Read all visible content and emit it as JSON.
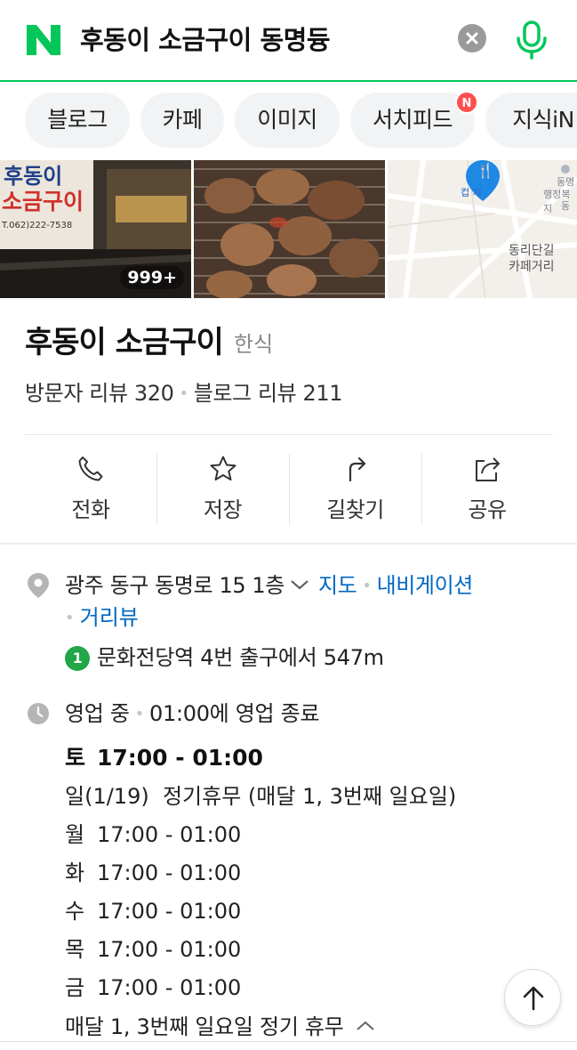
{
  "search": {
    "logo": "N",
    "query": "후동이 소금구이 동명듕"
  },
  "tabs": [
    {
      "label": "블로그"
    },
    {
      "label": "카페"
    },
    {
      "label": "이미지"
    },
    {
      "label": "서치피드",
      "badge": "N"
    },
    {
      "label": "지식iN"
    }
  ],
  "photos": {
    "sign_line1": "후동이",
    "sign_line2": "소금구이",
    "sign_phone": "T.062)222-7538",
    "count": "999+",
    "map_label1": "동리단길",
    "map_label2": "카페거리",
    "map_label3": "동명",
    "map_label4": "행정복지",
    "map_label5": "동",
    "map_pin_text": "컵",
    "map_pin_text2": "지"
  },
  "place": {
    "name": "후동이 소금구이",
    "category": "한식",
    "visitor_reviews": "방문자 리뷰 320",
    "blog_reviews": "블로그 리뷰 211"
  },
  "actions": [
    {
      "label": "전화",
      "icon": "phone-icon"
    },
    {
      "label": "저장",
      "icon": "star-icon"
    },
    {
      "label": "길찾기",
      "icon": "directions-icon"
    },
    {
      "label": "공유",
      "icon": "share-icon"
    }
  ],
  "address": {
    "text": "광주 동구 동명로 15 1층",
    "map_link": "지도",
    "nav_link": "내비게이션",
    "streetview_link": "거리뷰"
  },
  "subway": {
    "line": "1",
    "line_color": "#22a648",
    "text": "문화전당역 4번 출구에서 547m"
  },
  "hours": {
    "status": "영업 중",
    "closing": "01:00에 영업 종료",
    "rows": [
      {
        "day": "토",
        "time": "17:00 - 01:00"
      },
      {
        "day": "일(1/19)",
        "time": "정기휴무 (매달 1, 3번째 일요일)"
      },
      {
        "day": "월",
        "time": "17:00 - 01:00"
      },
      {
        "day": "화",
        "time": "17:00 - 01:00"
      },
      {
        "day": "수",
        "time": "17:00 - 01:00"
      },
      {
        "day": "목",
        "time": "17:00 - 01:00"
      },
      {
        "day": "금",
        "time": "17:00 - 01:00"
      }
    ],
    "holiday_note": "매달 1, 3번째 일요일 정기 휴무"
  },
  "colors": {
    "brand_green": "#03c75a",
    "link_blue": "#0068c3"
  }
}
